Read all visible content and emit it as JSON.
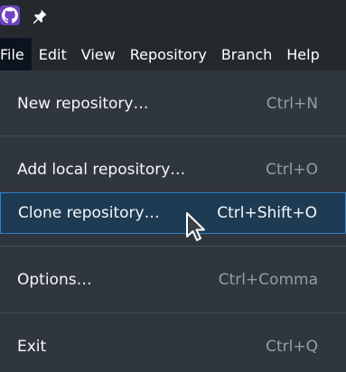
{
  "titlebar": {
    "app_icon": "github-octocat-icon",
    "pin_icon": "pin-icon"
  },
  "menubar": {
    "items": [
      {
        "label": "File"
      },
      {
        "label": "Edit"
      },
      {
        "label": "View"
      },
      {
        "label": "Repository"
      },
      {
        "label": "Branch"
      },
      {
        "label": "Help"
      }
    ]
  },
  "file_menu": {
    "items": [
      {
        "label": "New repository…",
        "shortcut": "Ctrl+N"
      },
      {
        "label": "Add local repository…",
        "shortcut": "Ctrl+O"
      },
      {
        "label": "Clone repository…",
        "shortcut": "Ctrl+Shift+O"
      },
      {
        "label": "Options…",
        "shortcut": "Ctrl+Comma"
      },
      {
        "label": "Exit",
        "shortcut": "Ctrl+Q"
      }
    ]
  },
  "colors": {
    "background": "#24292e",
    "menu_background": "#2f363d",
    "highlight": "#1d3b53",
    "highlight_border": "#2f81c7",
    "app_icon": "#6f42c1"
  }
}
